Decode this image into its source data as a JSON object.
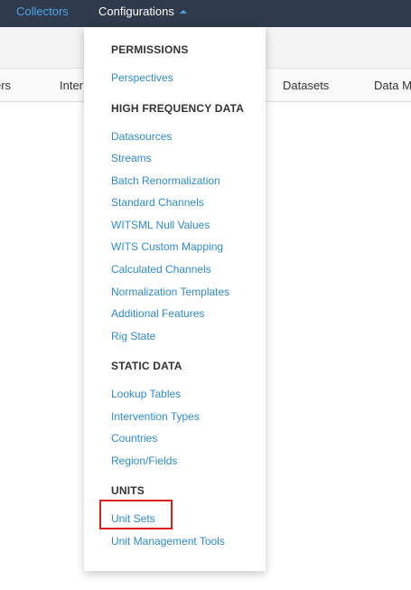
{
  "topnav": {
    "collectors": "Collectors",
    "configurations": "Configurations"
  },
  "tabs": [
    "ers",
    "Inter",
    "Datasets",
    "Data M"
  ],
  "menu": {
    "permissions": {
      "header": "PERMISSIONS",
      "items": [
        "Perspectives"
      ]
    },
    "high_frequency_data": {
      "header": "HIGH FREQUENCY DATA",
      "items": [
        "Datasources",
        "Streams",
        "Batch Renormalization",
        "Standard Channels",
        "WITSML Null Values",
        "WITS Custom Mapping",
        "Calculated Channels",
        "Normalization Templates",
        "Additional Features",
        "Rig State"
      ]
    },
    "static_data": {
      "header": "STATIC DATA",
      "items": [
        "Lookup Tables",
        "Intervention Types",
        "Countries",
        "Region/Fields"
      ]
    },
    "units": {
      "header": "UNITS",
      "items": [
        "Unit Sets",
        "Unit Management Tools"
      ]
    }
  },
  "colors": {
    "topbar_bg": "#2f3b4c",
    "link": "#2e8bd1",
    "highlight": "#e01e1e"
  }
}
